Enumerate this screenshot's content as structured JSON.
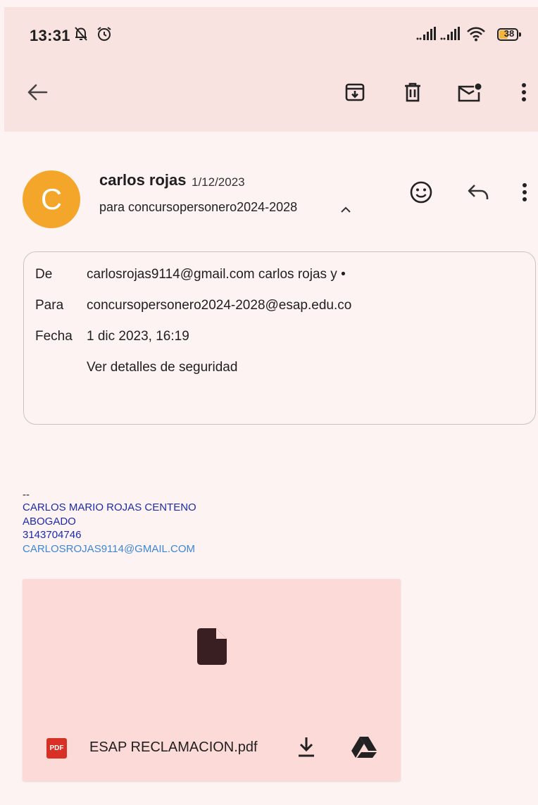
{
  "status_bar": {
    "time": "13:31",
    "battery": "38",
    "icons": [
      "notifications-off-icon",
      "alarm-icon",
      "signal-1-icon",
      "signal-2-icon",
      "wifi-icon",
      "battery-icon"
    ]
  },
  "app_bar": {
    "icons": [
      "back-arrow-icon",
      "archive-icon",
      "delete-icon",
      "mark-unread-icon",
      "more-vert-icon"
    ]
  },
  "message": {
    "avatar_letter": "C",
    "sender_name": "carlos rojas",
    "date": "1/12/2023",
    "to_line": "para concursopersonero2024-2028",
    "avatar_color": "#f4a62a"
  },
  "details": {
    "from_label": "De",
    "from_value": "carlosrojas9114@gmail.com carlos rojas y •",
    "to_label": "Para",
    "to_value": "concursopersonero2024-2028@esap.edu.co",
    "date_label": "Fecha",
    "date_value": "1 dic 2023, 16:19",
    "security_link": "Ver detalles de seguridad"
  },
  "signature": {
    "dashes": "--",
    "name": "CARLOS MARIO ROJAS CENTENO",
    "title": "ABOGADO",
    "phone": "3143704746",
    "email": "CARLOSROJAS9114@GMAIL.COM"
  },
  "attachment": {
    "type_badge": "PDF",
    "filename": "ESAP RECLAMACION.pdf",
    "accent": "#d93025"
  }
}
